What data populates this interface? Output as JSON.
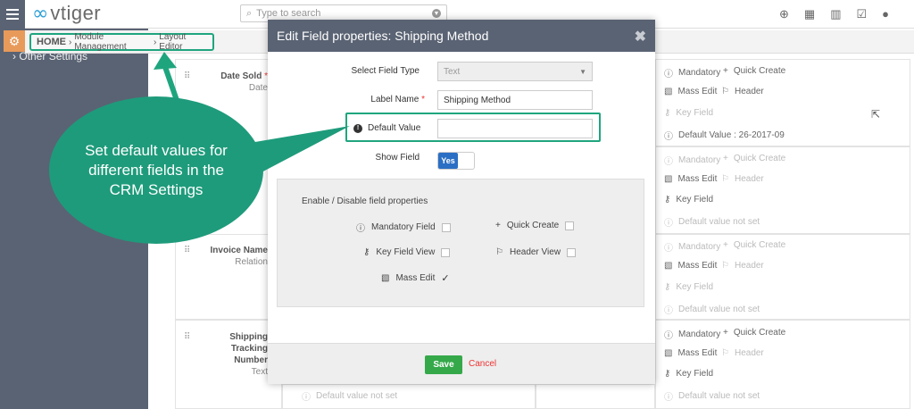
{
  "app": {
    "logo_text": "vtiger",
    "logo_mark": "∞"
  },
  "search": {
    "placeholder": "Type to search"
  },
  "top_icons": [
    "plus-icon",
    "calendar-icon",
    "chart-icon",
    "checkbox-icon",
    "user-icon"
  ],
  "sidebar": {
    "other_settings": "Other Settings"
  },
  "breadcrumb": {
    "home": "HOME",
    "item1": "Module Management",
    "item2": "Layout Editor"
  },
  "fields": {
    "date_sold": {
      "label": "Date Sold",
      "sub": "Date"
    },
    "invoice_name": {
      "label": "Invoice Name",
      "sub": "Relation"
    },
    "shipping": {
      "label1": "Shipping",
      "label2": "Tracking",
      "label3": "Number",
      "sub": "Text"
    }
  },
  "right_col": {
    "mandatory": "Mandatory",
    "quick_create": "Quick Create",
    "mass_edit": "Mass Edit",
    "header": "Header",
    "key_field": "Key Field",
    "default_value": "Default Value : 26-2017-09",
    "default_not_set": "Default value not set"
  },
  "modal": {
    "title": "Edit Field properties: Shipping Method",
    "select_field_type_label": "Select Field Type",
    "select_field_type_value": "Text",
    "label_name_label": "Label Name",
    "label_name_value": "Shipping Method",
    "default_value_label": "Default Value",
    "default_value_value": "",
    "show_field_label": "Show Field",
    "toggle_on": "Yes",
    "props_title": "Enable / Disable field properties",
    "mandatory_field": "Mandatory Field",
    "quick_create": "Quick Create",
    "key_field_view": "Key Field View",
    "header_view": "Header View",
    "mass_edit": "Mass Edit",
    "save": "Save",
    "cancel": "Cancel"
  },
  "callout": {
    "text": "Set default values for different fields in the CRM Settings"
  },
  "colors": {
    "accent": "#1fa57e",
    "header": "#5a6373",
    "save": "#35a94a",
    "cancel": "#ee3333",
    "toggle": "#2a6fc4"
  }
}
